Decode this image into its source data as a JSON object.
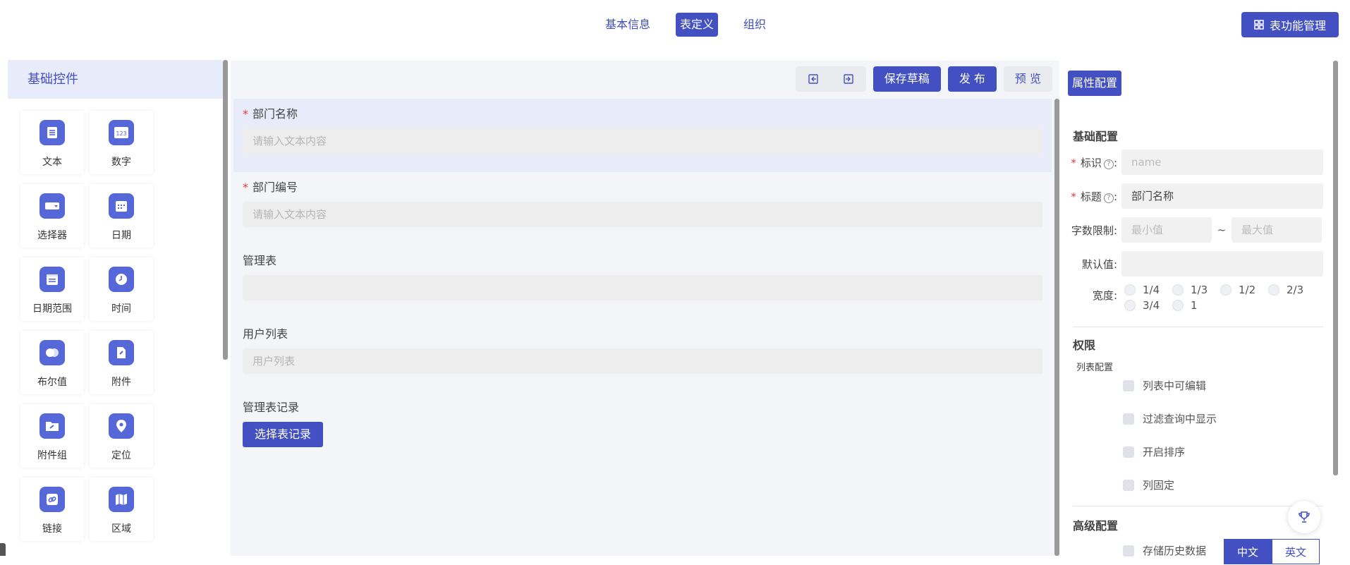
{
  "header": {
    "tabs": [
      {
        "label": "基本信息",
        "active": false
      },
      {
        "label": "表定义",
        "active": true
      },
      {
        "label": "组织",
        "active": false
      }
    ],
    "manage_button": "表功能管理"
  },
  "left_panel": {
    "title": "基础控件",
    "controls": [
      {
        "label": "文本",
        "icon": "text-icon"
      },
      {
        "label": "数字",
        "icon": "number-icon"
      },
      {
        "label": "选择器",
        "icon": "selector-icon"
      },
      {
        "label": "日期",
        "icon": "date-icon"
      },
      {
        "label": "日期范围",
        "icon": "date-range-icon"
      },
      {
        "label": "时间",
        "icon": "time-icon"
      },
      {
        "label": "布尔值",
        "icon": "boolean-icon"
      },
      {
        "label": "附件",
        "icon": "attachment-icon"
      },
      {
        "label": "附件组",
        "icon": "attachment-group-icon"
      },
      {
        "label": "定位",
        "icon": "location-icon"
      },
      {
        "label": "链接",
        "icon": "link-icon"
      },
      {
        "label": "区域",
        "icon": "region-icon"
      }
    ]
  },
  "toolbar": {
    "icon_left": "collapse-left-icon",
    "icon_right": "collapse-right-icon",
    "save_draft": "保存草稿",
    "publish": "发 布",
    "preview": "预 览"
  },
  "form": {
    "fields": [
      {
        "label": "部门名称",
        "required": true,
        "placeholder": "请输入文本内容"
      },
      {
        "label": "部门编号",
        "required": true,
        "placeholder": "请输入文本内容"
      },
      {
        "label": "管理表",
        "required": false,
        "placeholder": ""
      },
      {
        "label": "用户列表",
        "required": false,
        "placeholder": "用户列表"
      },
      {
        "label": "管理表记录",
        "required": false,
        "button": "选择表记录"
      }
    ]
  },
  "properties": {
    "tab_label": "属性配置",
    "basic_title": "基础配置",
    "id_label": "标识",
    "id_placeholder": "name",
    "title_label": "标题",
    "title_value": "部门名称",
    "limit_label": "字数限制",
    "min_placeholder": "最小值",
    "max_placeholder": "最大值",
    "tilde": "~",
    "default_label": "默认值",
    "width_label": "宽度",
    "width_options": [
      "1/4",
      "1/3",
      "1/2",
      "2/3",
      "3/4",
      "1"
    ],
    "permission_title": "权限",
    "list_config_title": "列表配置",
    "list_options": [
      "列表中可编辑",
      "过滤查询中显示",
      "开启排序",
      "列固定"
    ],
    "advanced_title": "高级配置",
    "history_label": "存储历史数据",
    "lang_options": [
      "中文",
      "英文"
    ],
    "required_mark": "*",
    "help_mark": "?",
    "colon": ":"
  },
  "colors": {
    "primary": "#4350c2",
    "selected_bg": "#e8ebfa",
    "required": "#e03c3c"
  }
}
